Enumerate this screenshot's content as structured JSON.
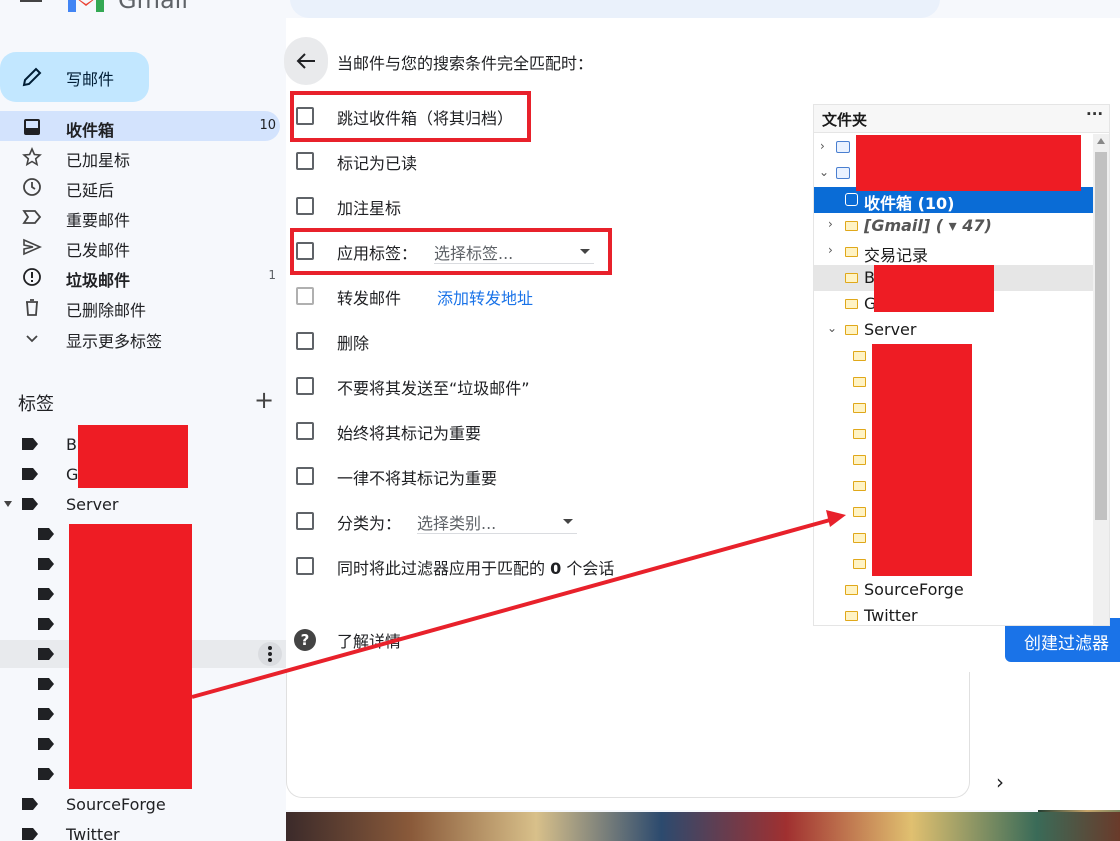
{
  "app": {
    "name": "Gmail"
  },
  "sidebar": {
    "compose_label": "写邮件",
    "items": [
      {
        "label": "收件箱",
        "count": "10",
        "icon": "inbox-icon",
        "active": true,
        "bold": true
      },
      {
        "label": "已加星标",
        "count": "",
        "icon": "star-icon"
      },
      {
        "label": "已延后",
        "count": "",
        "icon": "clock-icon"
      },
      {
        "label": "重要邮件",
        "count": "",
        "icon": "important-icon"
      },
      {
        "label": "已发邮件",
        "count": "",
        "icon": "send-icon"
      },
      {
        "label": "垃圾邮件",
        "count": "1",
        "icon": "spam-icon",
        "bold": true
      },
      {
        "label": "已删除邮件",
        "count": "",
        "icon": "trash-icon"
      },
      {
        "label": "显示更多标签",
        "count": "",
        "icon": "chevron-down-icon"
      }
    ],
    "labels_header": "标签",
    "labels": [
      {
        "label": "B"
      },
      {
        "label": "G"
      },
      {
        "label": "Server"
      },
      {
        "label": "SourceForge"
      },
      {
        "label": "Twitter"
      }
    ]
  },
  "filter": {
    "match_text": "当邮件与您的搜索条件完全匹配时：",
    "options": {
      "skip_inbox": "跳过收件箱（将其归档）",
      "mark_read": "标记为已读",
      "star": "加注星标",
      "apply_label": "应用标签：",
      "apply_label_placeholder": "选择标签...",
      "forward": "转发邮件",
      "forward_link": "添加转发地址",
      "delete": "删除",
      "never_spam": "不要将其发送至“垃圾邮件”",
      "always_important": "始终将其标记为重要",
      "never_important": "一律不将其标记为重要",
      "categorize": "分类为：",
      "categorize_placeholder": "选择类别...",
      "also_apply_pre": "同时将此过滤器应用于匹配的",
      "also_apply_count": "0",
      "also_apply_post": "个会话"
    },
    "help": "了解详情",
    "create_button": "创建过滤器"
  },
  "folder_pane": {
    "title": "文件夹",
    "more": "···",
    "inbox": "收件箱 (10)",
    "gmail": "[Gmail] ( ▾ 47)",
    "transactions": "交易记录",
    "b": "B",
    "g": "G",
    "server": "Server",
    "sourceforge": "SourceForge",
    "twitter": "Twitter"
  },
  "colors": {
    "accent": "#1a73e8",
    "highlight": "#e8212b",
    "redaction": "#ee1c24",
    "selected": "#0a6cd6"
  }
}
